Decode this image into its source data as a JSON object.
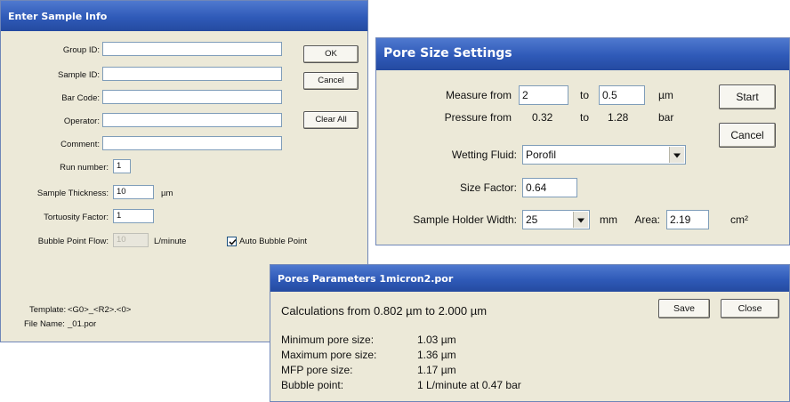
{
  "sample_info": {
    "title": "Enter Sample Info",
    "labels": {
      "group_id": "Group ID:",
      "sample_id": "Sample ID:",
      "bar_code": "Bar Code:",
      "operator": "Operator:",
      "comment": "Comment:",
      "run_number": "Run number:",
      "sample_thickness": "Sample Thickness:",
      "tortuosity_factor": "Tortuosity Factor:",
      "bubble_point_flow": "Bubble Point Flow:"
    },
    "values": {
      "group_id": "",
      "sample_id": "",
      "bar_code": "",
      "operator": "",
      "comment": "",
      "run_number": "1",
      "sample_thickness": "10",
      "tortuosity_factor": "1",
      "bubble_point_flow": "10"
    },
    "units": {
      "thickness": "µm",
      "flow": "L/minute"
    },
    "buttons": {
      "ok": "OK",
      "cancel": "Cancel",
      "clear_all": "Clear All"
    },
    "auto_bubble_point": {
      "label": "Auto Bubble Point",
      "checked": true
    },
    "template_label": "Template:",
    "template_value": "<G0>_<R2>.<0>",
    "file_name_label": "File Name:",
    "file_name_value": "_01.por"
  },
  "pore_settings": {
    "title": "Pore Size Settings",
    "measure_from_label": "Measure from",
    "measure_from": "2",
    "to_label": "to",
    "measure_to": "0.5",
    "measure_unit": "µm",
    "pressure_from_label": "Pressure from",
    "pressure_from": "0.32",
    "pressure_to": "1.28",
    "pressure_unit": "bar",
    "wetting_fluid_label": "Wetting Fluid:",
    "wetting_fluid": "Porofil",
    "size_factor_label": "Size Factor:",
    "size_factor": "0.64",
    "holder_width_label": "Sample Holder Width:",
    "holder_width": "25",
    "holder_unit": "mm",
    "area_label": "Area:",
    "area": "2.19",
    "area_unit": "cm²",
    "buttons": {
      "start": "Start",
      "cancel": "Cancel"
    }
  },
  "pores_parameters": {
    "title": "Pores Parameters   1micron2.por",
    "calc_line": "Calculations from 0.802 µm to 2.000 µm",
    "rows": [
      {
        "label": "Minimum pore size:",
        "value": "1.03 µm"
      },
      {
        "label": "Maximum pore size:",
        "value": "1.36 µm"
      },
      {
        "label": "MFP pore size:",
        "value": "1.17 µm"
      },
      {
        "label": "Bubble point:",
        "value": "1 L/minute at 0.47 bar"
      }
    ],
    "buttons": {
      "save": "Save",
      "close": "Close"
    }
  }
}
